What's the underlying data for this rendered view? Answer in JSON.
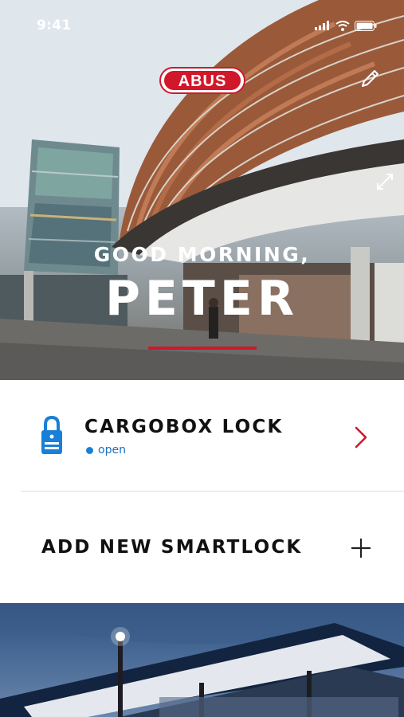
{
  "status_bar": {
    "time": "9:41"
  },
  "brand": {
    "logo_text": "ABUS",
    "accent_color": "#d1172a"
  },
  "hero": {
    "greeting": "GOOD MORNING,",
    "name": "PETER"
  },
  "locks": [
    {
      "name": "CARGOBOX LOCK",
      "status": "open",
      "status_color": "#1a7fd8",
      "icon": "padlock-icon"
    }
  ],
  "add_lock": {
    "label": "ADD NEW SMARTLOCK",
    "icon": "plus-icon"
  },
  "icons": {
    "edit": "pencil-icon",
    "expand": "expand-icon",
    "chevron": "chevron-right-icon"
  }
}
